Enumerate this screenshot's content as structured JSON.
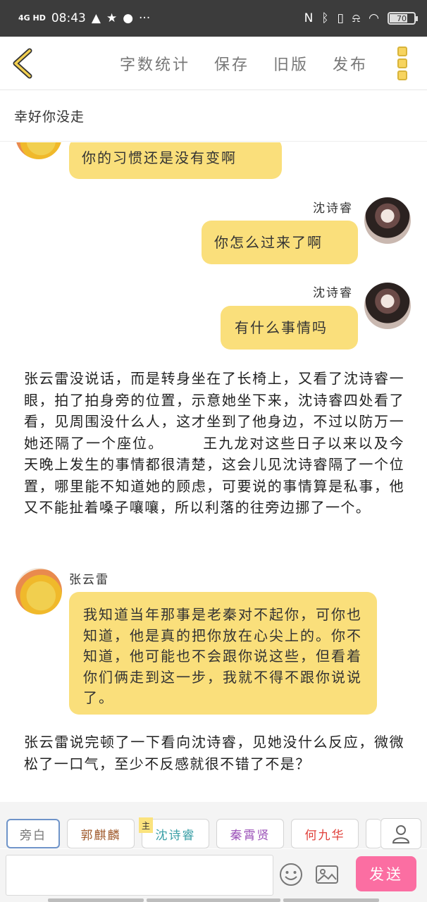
{
  "status_bar": {
    "network": "4G HD",
    "time": "08:43",
    "battery": "70"
  },
  "toolbar": {
    "items": [
      "字数统计",
      "保存",
      "旧版",
      "发布"
    ]
  },
  "story_title": "幸好你没走",
  "messages": {
    "m0_text": "你的习惯还是没有变啊",
    "m1_name": "沈诗睿",
    "m1_text": "你怎么过来了啊",
    "m2_name": "沈诗睿",
    "m2_text": "有什么事情吗",
    "narration1": "张云雷没说话，而是转身坐在了长椅上，又看了沈诗睿一眼，拍了拍身旁的位置，示意她坐下来，沈诗睿四处看了看，见周围没什么人，这才坐到了他身边，不过以防万一她还隔了一个座位。　　　王九龙对这些日子以来以及今天晚上发生的事情都很清楚，这会儿见沈诗睿隔了一个位置，哪里能不知道她的顾虑，可要说的事情算是私事，他又不能扯着嗓子嚷嚷，所以利落的往旁边挪了一个。",
    "m3_name": "张云雷",
    "m3_text": "我知道当年那事是老秦对不起你，可你也知道，他是真的把你放在心尖上的。你不知道，他可能也不会跟你说这些，但看着你们俩走到这一步，我就不得不跟你说说了。",
    "narration2": "张云雷说完顿了一下看向沈诗睿，见她没什么反应，微微松了一口气，至少不反感就很不错了不是？"
  },
  "characters": {
    "narrator": "旁白",
    "c1": "郭麒麟",
    "c2": "沈诗睿",
    "c2_badge": "主",
    "c3": "秦霄贤",
    "c4": "何九华"
  },
  "composer": {
    "input_value": "",
    "send_label": "发送"
  },
  "colors": {
    "bubble": "#fadf7b",
    "send": "#fb6ea2",
    "accent": "#f7d45f"
  }
}
